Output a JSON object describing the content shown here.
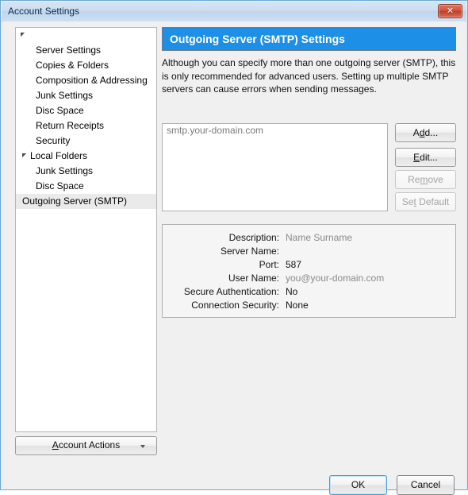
{
  "window": {
    "title": "Account Settings",
    "close_label": "✕"
  },
  "sidebar": {
    "items": [
      {
        "label": "",
        "level": "root",
        "twisty": true,
        "selected": false
      },
      {
        "label": "Server Settings",
        "level": "level2",
        "twisty": false,
        "selected": false
      },
      {
        "label": "Copies & Folders",
        "level": "level2",
        "twisty": false,
        "selected": false
      },
      {
        "label": "Composition & Addressing",
        "level": "level2",
        "twisty": false,
        "selected": false
      },
      {
        "label": "Junk Settings",
        "level": "level2",
        "twisty": false,
        "selected": false
      },
      {
        "label": "Disc Space",
        "level": "level2",
        "twisty": false,
        "selected": false
      },
      {
        "label": "Return Receipts",
        "level": "level2",
        "twisty": false,
        "selected": false
      },
      {
        "label": "Security",
        "level": "level2",
        "twisty": false,
        "selected": false
      },
      {
        "label": "Local Folders",
        "level": "level1",
        "twisty": true,
        "selected": false
      },
      {
        "label": "Junk Settings",
        "level": "level2",
        "twisty": false,
        "selected": false
      },
      {
        "label": "Disc Space",
        "level": "level2",
        "twisty": false,
        "selected": false
      },
      {
        "label": "Outgoing Server (SMTP)",
        "level": "level1",
        "twisty": false,
        "selected": true
      }
    ],
    "account_actions": {
      "label": "Account Actions",
      "accel": "A"
    }
  },
  "pane": {
    "header_title": "Outgoing Server (SMTP) Settings",
    "header_bg": "#1e8fe6",
    "description": "Although you can specify more than one outgoing server (SMTP), this is only recommended for advanced users. Setting up multiple SMTP servers can cause errors when sending messages."
  },
  "server_list": {
    "items": [
      {
        "label": "smtp.your-domain.com"
      }
    ]
  },
  "side_buttons": [
    {
      "id": "btn-add",
      "label": "Add...",
      "accel": "d",
      "enabled": true
    },
    {
      "id": "btn-edit",
      "label": "Edit...",
      "accel": "E",
      "enabled": true
    },
    {
      "id": "btn-remove",
      "label": "Remove",
      "accel": "m",
      "enabled": false
    },
    {
      "id": "btn-setdefault",
      "label": "Set Default",
      "accel": "t",
      "enabled": false
    }
  ],
  "details": {
    "rows": [
      {
        "label": "Description:",
        "value": "Name Surname",
        "muted": true
      },
      {
        "label": "Server Name:",
        "value": "",
        "muted": false
      },
      {
        "label": "Port:",
        "value": "587",
        "muted": false
      },
      {
        "label": "User Name:",
        "value": "you@your-domain.com",
        "muted": true
      },
      {
        "label": "Secure Authentication:",
        "value": "No",
        "muted": false
      },
      {
        "label": "Connection Security:",
        "value": "None",
        "muted": false
      }
    ]
  },
  "footer": {
    "ok_label": "OK",
    "cancel_label": "Cancel"
  }
}
